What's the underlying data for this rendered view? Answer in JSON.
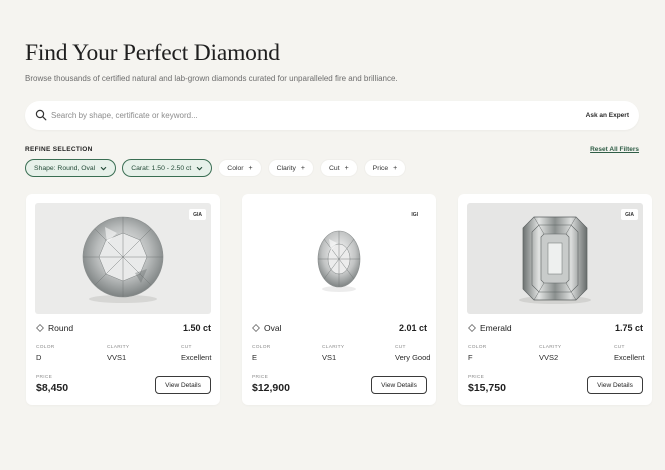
{
  "header": {
    "title": "Find Your Perfect Diamond",
    "subtitle": "Browse thousands of certified natural and lab-grown diamonds curated for unparalleled fire and brilliance."
  },
  "search": {
    "placeholder": "Search by shape, certificate or keyword...",
    "value": "",
    "expert_label": "Ask an Expert"
  },
  "filters": {
    "heading": "REFINE SELECTION",
    "reset_label": "Reset All Filters",
    "active": [
      {
        "label": "Shape: Round, Oval",
        "icon": "chevron-down-icon"
      },
      {
        "label": "Carat: 1.50 - 2.50 ct",
        "icon": "chevron-down-icon"
      }
    ],
    "add": [
      {
        "label": "Color",
        "icon": "plus-icon"
      },
      {
        "label": "Clarity",
        "icon": "plus-icon"
      },
      {
        "label": "Cut",
        "icon": "plus-icon"
      },
      {
        "label": "Price",
        "icon": "plus-icon"
      }
    ]
  },
  "spec_labels": {
    "color": "COLOR",
    "clarity": "CLARITY",
    "cut": "CUT",
    "price": "PRICE"
  },
  "view_details_label": "View Details",
  "products": [
    {
      "shape": "Round",
      "carat": "1.50 ct",
      "cert": "GIA",
      "color": "D",
      "clarity": "VVS1",
      "cut": "Excellent",
      "price": "$8,450"
    },
    {
      "shape": "Oval",
      "carat": "2.01 ct",
      "cert": "IGI",
      "color": "E",
      "clarity": "VS1",
      "cut": "Very Good",
      "price": "$12,900"
    },
    {
      "shape": "Emerald",
      "carat": "1.75 ct",
      "cert": "GIA",
      "color": "F",
      "clarity": "VVS2",
      "cut": "Excellent",
      "price": "$15,750"
    }
  ],
  "colors": {
    "accent": "#3a6e53",
    "accent_bg": "#e7f1ea",
    "background": "#f5f4f0"
  }
}
